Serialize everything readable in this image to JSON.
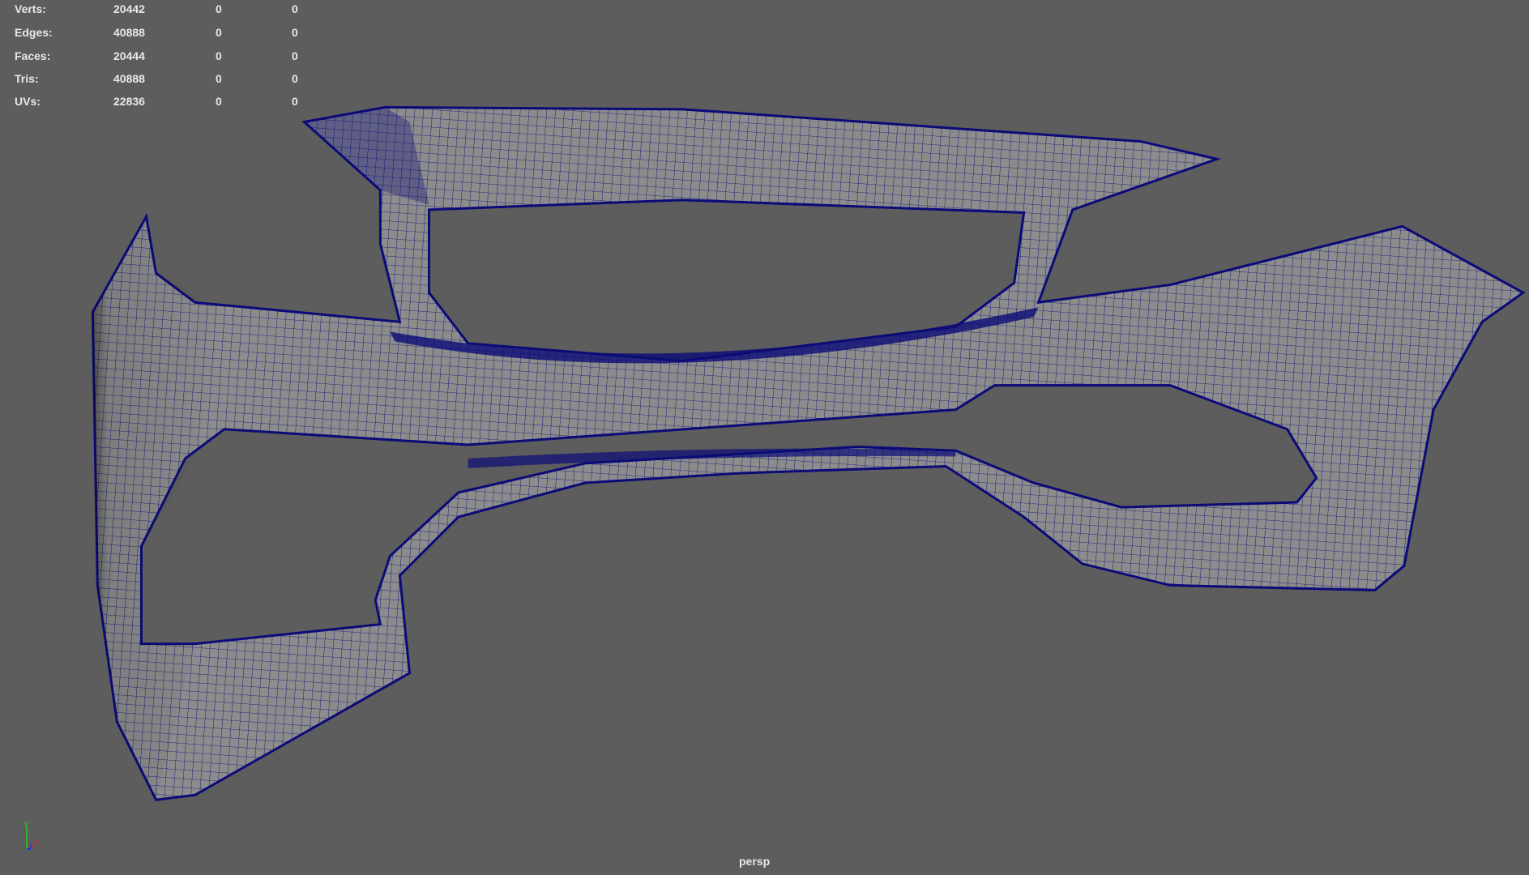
{
  "hud": {
    "rows": [
      {
        "label": "Verts:",
        "total": "20442",
        "selected": "0",
        "uv": "0"
      },
      {
        "label": "Edges:",
        "total": "40888",
        "selected": "0",
        "uv": "0"
      },
      {
        "label": "Faces:",
        "total": "20444",
        "selected": "0",
        "uv": "0"
      },
      {
        "label": "Tris:",
        "total": "40888",
        "selected": "0",
        "uv": "0"
      },
      {
        "label": "UVs:",
        "total": "22836",
        "selected": "0",
        "uv": "0"
      }
    ]
  },
  "viewport": {
    "camera_label": "persp",
    "background_color": "#5d5d5d",
    "wireframe_color": "#0b0b78",
    "mesh_color": "#8c8c8c"
  },
  "axis": {
    "x": "x",
    "y": "y",
    "z": "z",
    "x_color": "#e02020",
    "y_color": "#20d020",
    "z_color": "#2030e0"
  }
}
